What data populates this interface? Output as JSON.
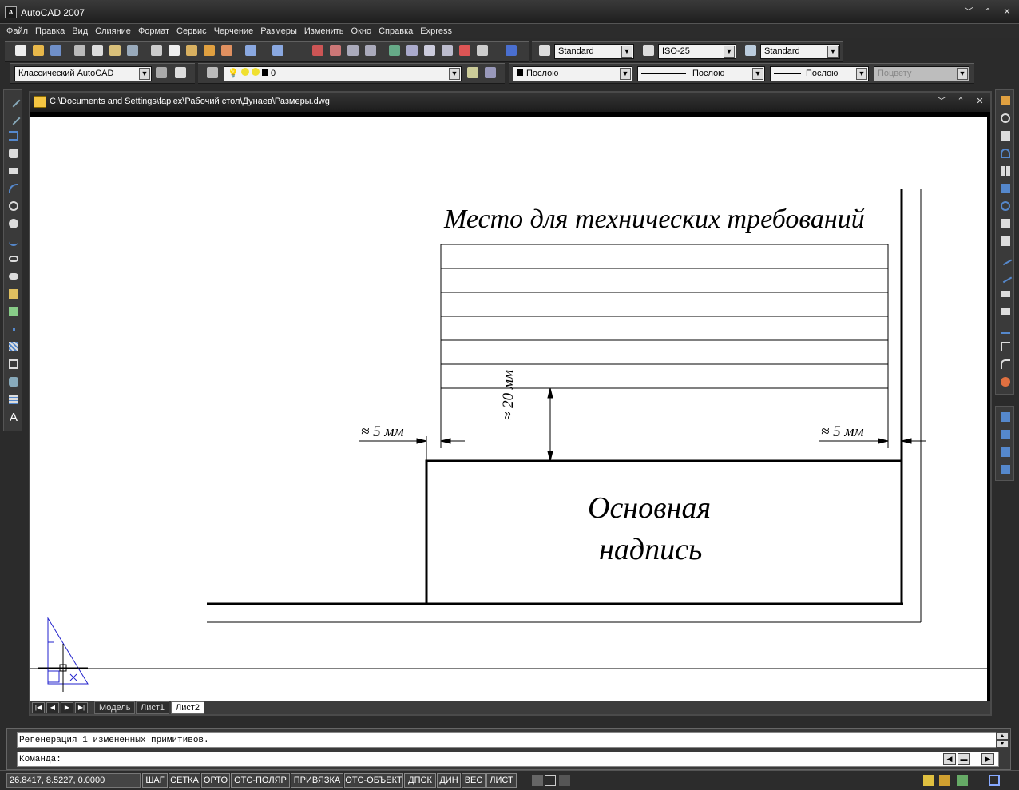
{
  "app": {
    "title": "AutoCAD 2007",
    "logo_text": "A"
  },
  "window_controls": {
    "minimize": "﹀",
    "restore": "⌃",
    "close": "✕"
  },
  "menu": [
    "Файл",
    "Правка",
    "Вид",
    "Слияние",
    "Формат",
    "Сервис",
    "Черчение",
    "Размеры",
    "Изменить",
    "Окно",
    "Справка",
    "Express"
  ],
  "toolbar_styles": {
    "text_style": "Standard",
    "dim_style": "ISO-25",
    "table_style": "Standard"
  },
  "toolbar_layers": {
    "workspace": "Классический AutoCAD",
    "layer": "0",
    "color": "Послою",
    "linetype": "Послою",
    "lineweight": "Послою",
    "plotstyle": "Поцвету"
  },
  "drawing": {
    "file_path": "C:\\Documents and Settings\\faplex\\Рабочий стол\\Дунаев\\Размеры.dwg",
    "tech_req_label": "Место для технических требований",
    "title_block_line1": "Основная",
    "title_block_line2": "надпись",
    "dim_left": "≈ 5 мм",
    "dim_right": "≈ 5 мм",
    "dim_vertical": "≈ 20 мм"
  },
  "layout_tabs": [
    {
      "label": "Модель",
      "active": false
    },
    {
      "label": "Лист1",
      "active": false
    },
    {
      "label": "Лист2",
      "active": true
    }
  ],
  "command": {
    "history": "Регенерация 1 измененных примитивов.",
    "prompt": "Команда:"
  },
  "status": {
    "coordinates": "26.8417, 8.5227, 0.0000",
    "toggles": [
      "ШАГ",
      "СЕТКА",
      "ОРТО",
      "ОТС-ПОЛЯР",
      "ПРИВЯЗКА",
      "ОТС-ОБЪЕКТ",
      "ДПСК",
      "ДИН",
      "ВЕС",
      "ЛИСТ"
    ]
  },
  "colors": {
    "background": "#2b2b2b",
    "toolbar": "#3a3a3a",
    "paper": "#ffffff",
    "ucs_icon": "#2222cc"
  }
}
